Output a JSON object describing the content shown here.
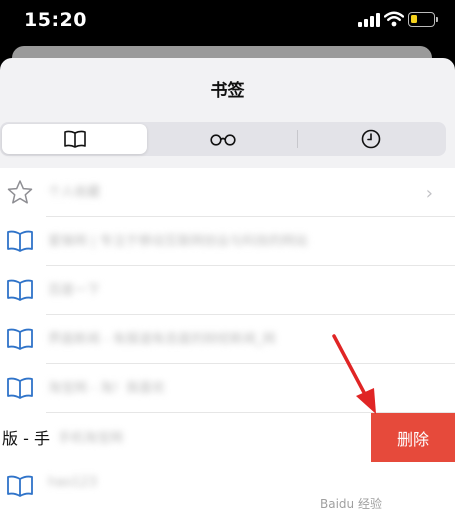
{
  "status_bar": {
    "time": "15:20"
  },
  "sheet": {
    "title": "书签",
    "tabs": [
      {
        "icon": "book-icon",
        "active": true
      },
      {
        "icon": "reading-list-glasses-icon",
        "active": false
      },
      {
        "icon": "history-clock-icon",
        "active": false
      }
    ]
  },
  "bookmarks": {
    "items": [
      {
        "icon": "star-icon",
        "label": "个人收藏",
        "folder": true
      },
      {
        "icon": "book-icon",
        "label": "爱锋网 | 专注于移动互联网创业与科技的网站"
      },
      {
        "icon": "book-icon",
        "label": "百度一下"
      },
      {
        "icon": "book-icon",
        "label": "界面新闻 - 有报道有态度的财经新闻_网"
      },
      {
        "icon": "book-icon",
        "label": "淘宝网 - 淘！我喜欢"
      }
    ],
    "swiped_item": {
      "partial_text": "版 - 手",
      "label": "手机淘宝网",
      "delete_label": "删除"
    },
    "last_item": {
      "icon": "book-icon",
      "label": "hao123"
    }
  },
  "colors": {
    "accent": "#2f73c9",
    "delete": "#e64a3b",
    "arrow": "#e02525"
  },
  "watermark": "Baidu 经验"
}
